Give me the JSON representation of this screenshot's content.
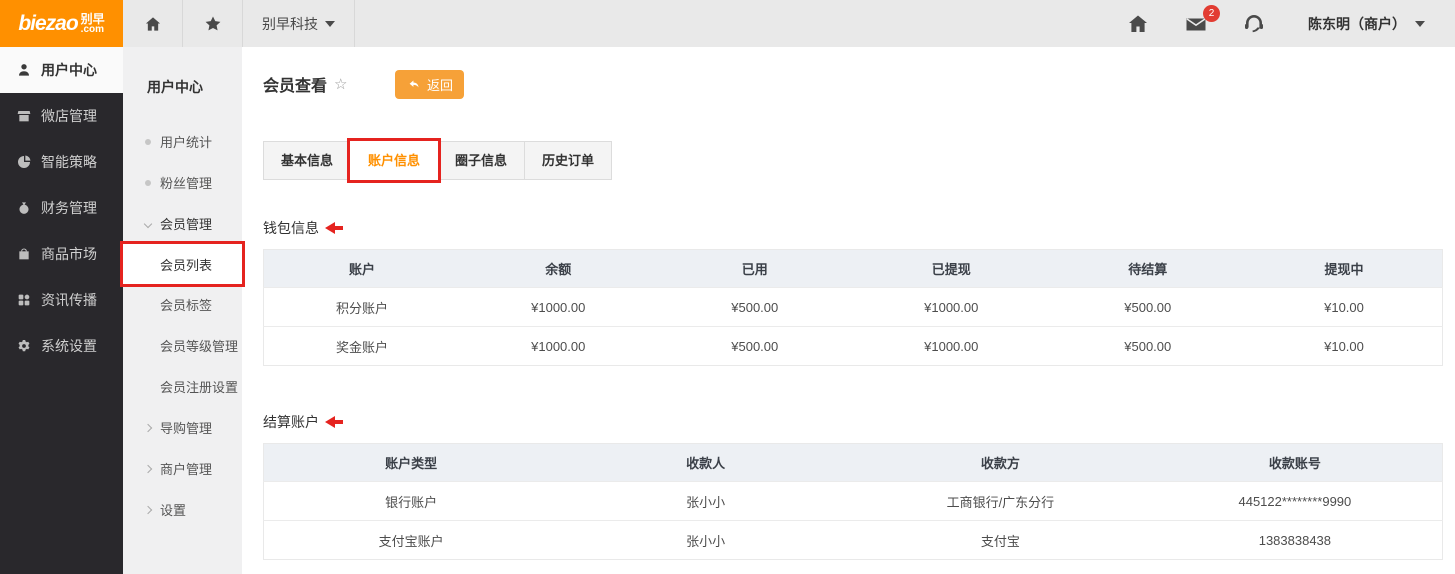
{
  "brand": {
    "logo_text": "biezao",
    "logo_cn": "别早",
    "logo_com": ".com"
  },
  "topbar": {
    "company": "别早科技",
    "mail_badge_count": "2",
    "user_name": "陈东明（商户）"
  },
  "sidebar": {
    "items": [
      {
        "label": "用户中心"
      },
      {
        "label": "微店管理"
      },
      {
        "label": "智能策略"
      },
      {
        "label": "财务管理"
      },
      {
        "label": "商品市场"
      },
      {
        "label": "资讯传播"
      },
      {
        "label": "系统设置"
      }
    ]
  },
  "submenu": {
    "title": "用户中心",
    "items": [
      {
        "label": "用户统计"
      },
      {
        "label": "粉丝管理"
      },
      {
        "label": "会员管理"
      },
      {
        "label": "会员列表"
      },
      {
        "label": "会员标签"
      },
      {
        "label": "会员等级管理"
      },
      {
        "label": "会员注册设置"
      },
      {
        "label": "导购管理"
      },
      {
        "label": "商户管理"
      },
      {
        "label": "设置"
      }
    ]
  },
  "page": {
    "title": "会员查看",
    "favorite_star": "☆",
    "back_label": "返回"
  },
  "tabs": [
    {
      "label": "基本信息"
    },
    {
      "label": "账户信息"
    },
    {
      "label": "圈子信息"
    },
    {
      "label": "历史订单"
    }
  ],
  "sections": {
    "wallet": "钱包信息",
    "settlement": "结算账户"
  },
  "wallet_table": {
    "headers": [
      "账户",
      "余额",
      "已用",
      "已提现",
      "待结算",
      "提现中"
    ],
    "rows": [
      [
        "积分账户",
        "¥1000.00",
        "¥500.00",
        "¥1000.00",
        "¥500.00",
        "¥10.00"
      ],
      [
        "奖金账户",
        "¥1000.00",
        "¥500.00",
        "¥1000.00",
        "¥500.00",
        "¥10.00"
      ]
    ]
  },
  "settlement_table": {
    "headers": [
      "账户类型",
      "收款人",
      "收款方",
      "收款账号"
    ],
    "rows": [
      [
        "银行账户",
        "张小小",
        "工商银行/广东分行",
        "445122********9990"
      ],
      [
        "支付宝账户",
        "张小小",
        "支付宝",
        "1383838438"
      ]
    ]
  },
  "colors": {
    "accent_orange": "#ff9000",
    "button_orange": "#f6a138",
    "annotation_red": "#e5231f",
    "badge_red": "#e23c32"
  }
}
